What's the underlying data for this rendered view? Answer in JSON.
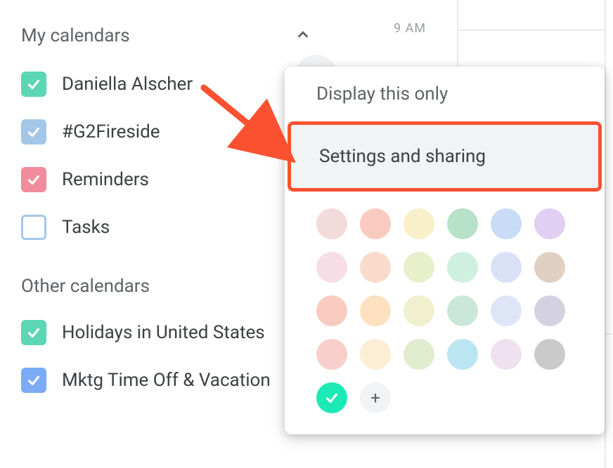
{
  "sidebar": {
    "my_calendars_title": "My calendars",
    "items": [
      {
        "label": "Daniella Alscher",
        "color": "#5cd6b3",
        "checked": true
      },
      {
        "label": "#G2Fireside",
        "color": "#a4c7e8",
        "checked": true
      },
      {
        "label": "Reminders",
        "color": "#f28b9b",
        "checked": true
      },
      {
        "label": "Tasks",
        "color": "#a4c7e8",
        "checked": false
      }
    ],
    "other_calendars_title": "Other calendars",
    "other_items": [
      {
        "label": "Holidays in United States",
        "color": "#5cd6b3",
        "checked": true
      },
      {
        "label": "Mktg Time Off & Vacation",
        "color": "#7baaf7",
        "checked": true
      }
    ]
  },
  "time": {
    "label": "9 AM"
  },
  "popup": {
    "display_only": "Display this only",
    "settings_sharing": "Settings and sharing",
    "colors": [
      "#e8bdbb",
      "#f4a08c",
      "#f2e3a0",
      "#7bc99a",
      "#9bbef0",
      "#c8a8ea",
      "#f1c2d2",
      "#f5bda0",
      "#d4e3a0",
      "#a8e3c2",
      "#bac8f0",
      "#c9a98e",
      "#f4a08c",
      "#f7c98a",
      "#e3e3a8",
      "#a0d4bb",
      "#c3d0f0",
      "#b0adc9",
      "#f2a8a0",
      "#f7e0b0",
      "#c8dca8",
      "#85d0e8",
      "#e3c8e3",
      "#9e9e9e"
    ],
    "selected_color": "#1de9b6",
    "add_label": "+"
  }
}
